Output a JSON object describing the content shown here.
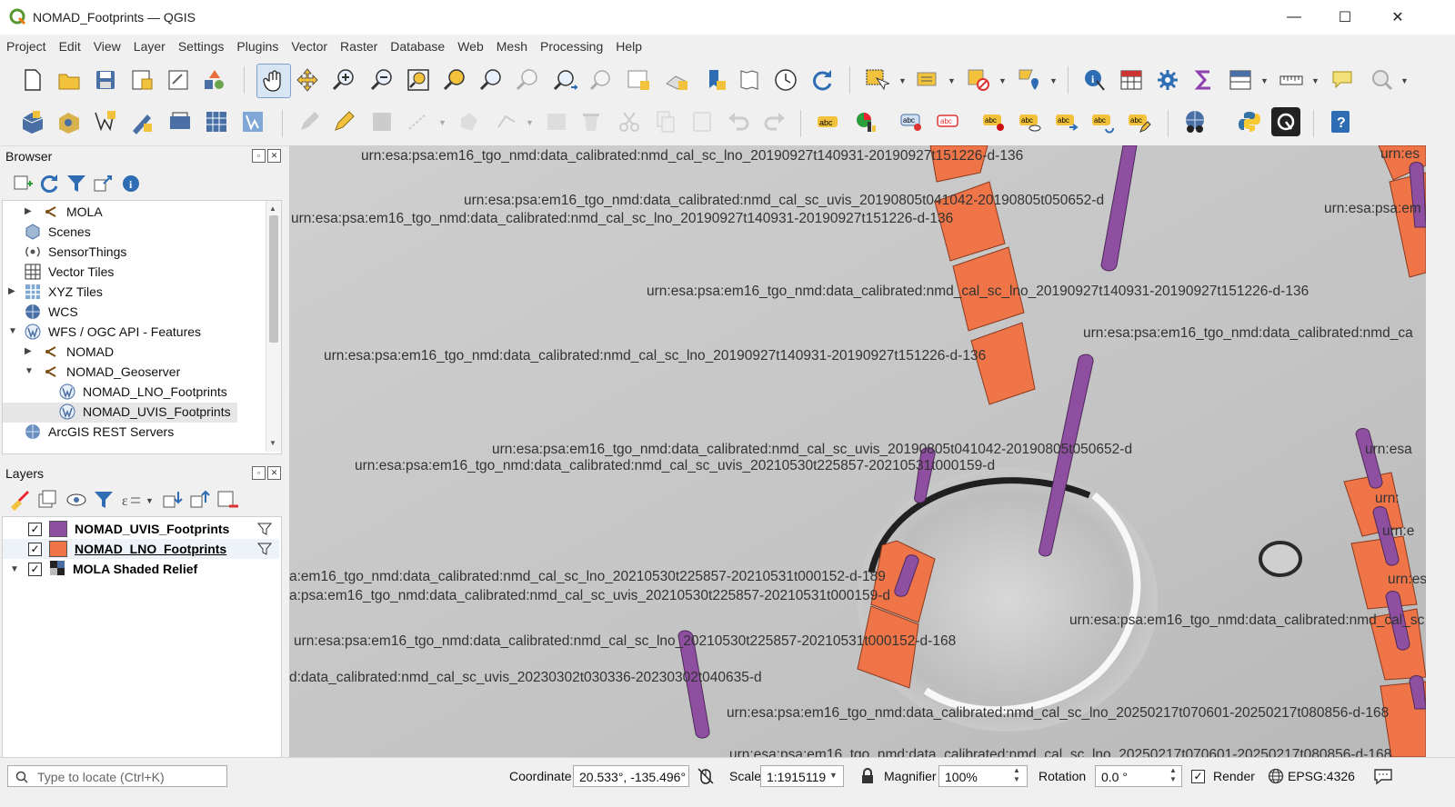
{
  "window": {
    "title": "NOMAD_Footprints — QGIS",
    "minimize": "—",
    "maximize": "☐",
    "close": "✕"
  },
  "menubar": [
    "Project",
    "Edit",
    "View",
    "Layer",
    "Settings",
    "Plugins",
    "Vector",
    "Raster",
    "Database",
    "Web",
    "Mesh",
    "Processing",
    "Help"
  ],
  "browser": {
    "title": "Browser",
    "items": [
      {
        "label": "MOLA",
        "icon": "connection-icon",
        "expander": "▶"
      },
      {
        "label": "Scenes",
        "icon": "scenes-icon",
        "expander": ""
      },
      {
        "label": "SensorThings",
        "icon": "sensorthings-icon",
        "expander": ""
      },
      {
        "label": "Vector Tiles",
        "icon": "vector-tiles-icon",
        "expander": ""
      },
      {
        "label": "XYZ Tiles",
        "icon": "xyz-tiles-icon",
        "expander": "▶"
      },
      {
        "label": "WCS",
        "icon": "wcs-icon",
        "expander": ""
      },
      {
        "label": "WFS / OGC API - Features",
        "icon": "wfs-icon",
        "expander": "▼"
      },
      {
        "label": "NOMAD",
        "icon": "connection-icon",
        "expander": "▶"
      },
      {
        "label": "NOMAD_Geoserver",
        "icon": "connection-icon",
        "expander": "▼"
      },
      {
        "label": "NOMAD_LNO_Footprints",
        "icon": "wfs-layer-icon",
        "expander": ""
      },
      {
        "label": "NOMAD_UVIS_Footprints",
        "icon": "wfs-layer-icon",
        "expander": ""
      },
      {
        "label": "ArcGIS REST Servers",
        "icon": "arcgis-icon",
        "expander": ""
      }
    ]
  },
  "layers": {
    "title": "Layers",
    "items": [
      {
        "label": "NOMAD_UVIS_Footprints",
        "color": "#8e4fa0",
        "checked": "✓",
        "expander": ""
      },
      {
        "label": "NOMAD_LNO_Footprints",
        "color": "#ef7448",
        "checked": "✓",
        "expander": ""
      },
      {
        "label": "MOLA Shaded Relief",
        "color": "",
        "checked": "✓",
        "expander": "▼"
      }
    ]
  },
  "map": {
    "lno_color": "#ef7448",
    "uvis_color": "#8e4fa0",
    "labels": [
      "urn:esa:psa:em16_tgo_nmd:data_calibrated:nmd_cal_sc_lno_20190927t140931-20190927t151226-d-136",
      "urn:esa:psa:em16_tgo_nmd:data_calibrated:nmd_cal_sc_uvis_20190805t041042-20190805t050652-d",
      "urn:esa:psa:em16_tgo_nmd:data_calibrated:nmd_cal_sc_lno_20190927t140931-20190927t151226-d-136",
      "urn:esa:psa:em16_tgo_nmd:data_calibrated:nmd_cal_sc_lno_20190927t140931-20190927t151226-d-136",
      "urn:esa:psa:em16_tgo_nmd:data_calibrated:nmd_ca",
      "urn:esa:psa:em16_tgo_nmd:data_calibrated:nmd_cal_sc_lno_20190927t140931-20190927t151226-d-136",
      "urn:esa:psa:em16_tgo_nmd:data_calibrated:nmd_cal_sc_uvis_20190805t041042-20190805t050652-d",
      "urn:esa:psa:em16_tgo_nmd:data_calibrated:nmd_cal_sc_uvis_20210530t225857-20210531t000159-d",
      "a:em16_tgo_nmd:data_calibrated:nmd_cal_sc_lno_20210530t225857-20210531t000152-d-189",
      "a:psa:em16_tgo_nmd:data_calibrated:nmd_cal_sc_uvis_20210530t225857-20210531t000159-d",
      "urn:esa:psa:em16_tgo_nmd:data_calibrated:nmd_cal_sc_lno_20210530t225857-20210531t000152-d-168",
      "urn:esa:psa:em16_tgo_nmd:data_calibrated:nmd_cal_sc",
      "d:data_calibrated:nmd_cal_sc_uvis_20230302t030336-20230302t040635-d",
      "urn:esa:psa:em16_tgo_nmd:data_calibrated:nmd_cal_sc_lno_20250217t070601-20250217t080856-d-168",
      "urn:esa:psa:em16_tgo_nmd:data_calibrated:nmd_cal_sc_lno_20250217t070601-20250217t080856-d-16",
      "urn:esa:psa:em",
      "urn:esa:psa",
      "urn:",
      "urn:esa",
      "urn:es",
      "urn:e",
      "urn:esa:psa:em16_tgo_nmd:data_calibrated:nmd_cal_sc_lno_20250217t070601-20250217t080856-d-168"
    ]
  },
  "statusbar": {
    "locator_placeholder": "Type to locate (Ctrl+K)",
    "coordinate_label": "Coordinate",
    "coordinate_value": "20.533°, -135.496°",
    "scale_label": "Scale",
    "scale_value": "1:1915119",
    "magnifier_label": "Magnifier",
    "magnifier_value": "100%",
    "rotation_label": "Rotation",
    "rotation_value": "0.0 °",
    "render_label": "Render",
    "render_checked": "✓",
    "crs_label": "EPSG:4326"
  }
}
